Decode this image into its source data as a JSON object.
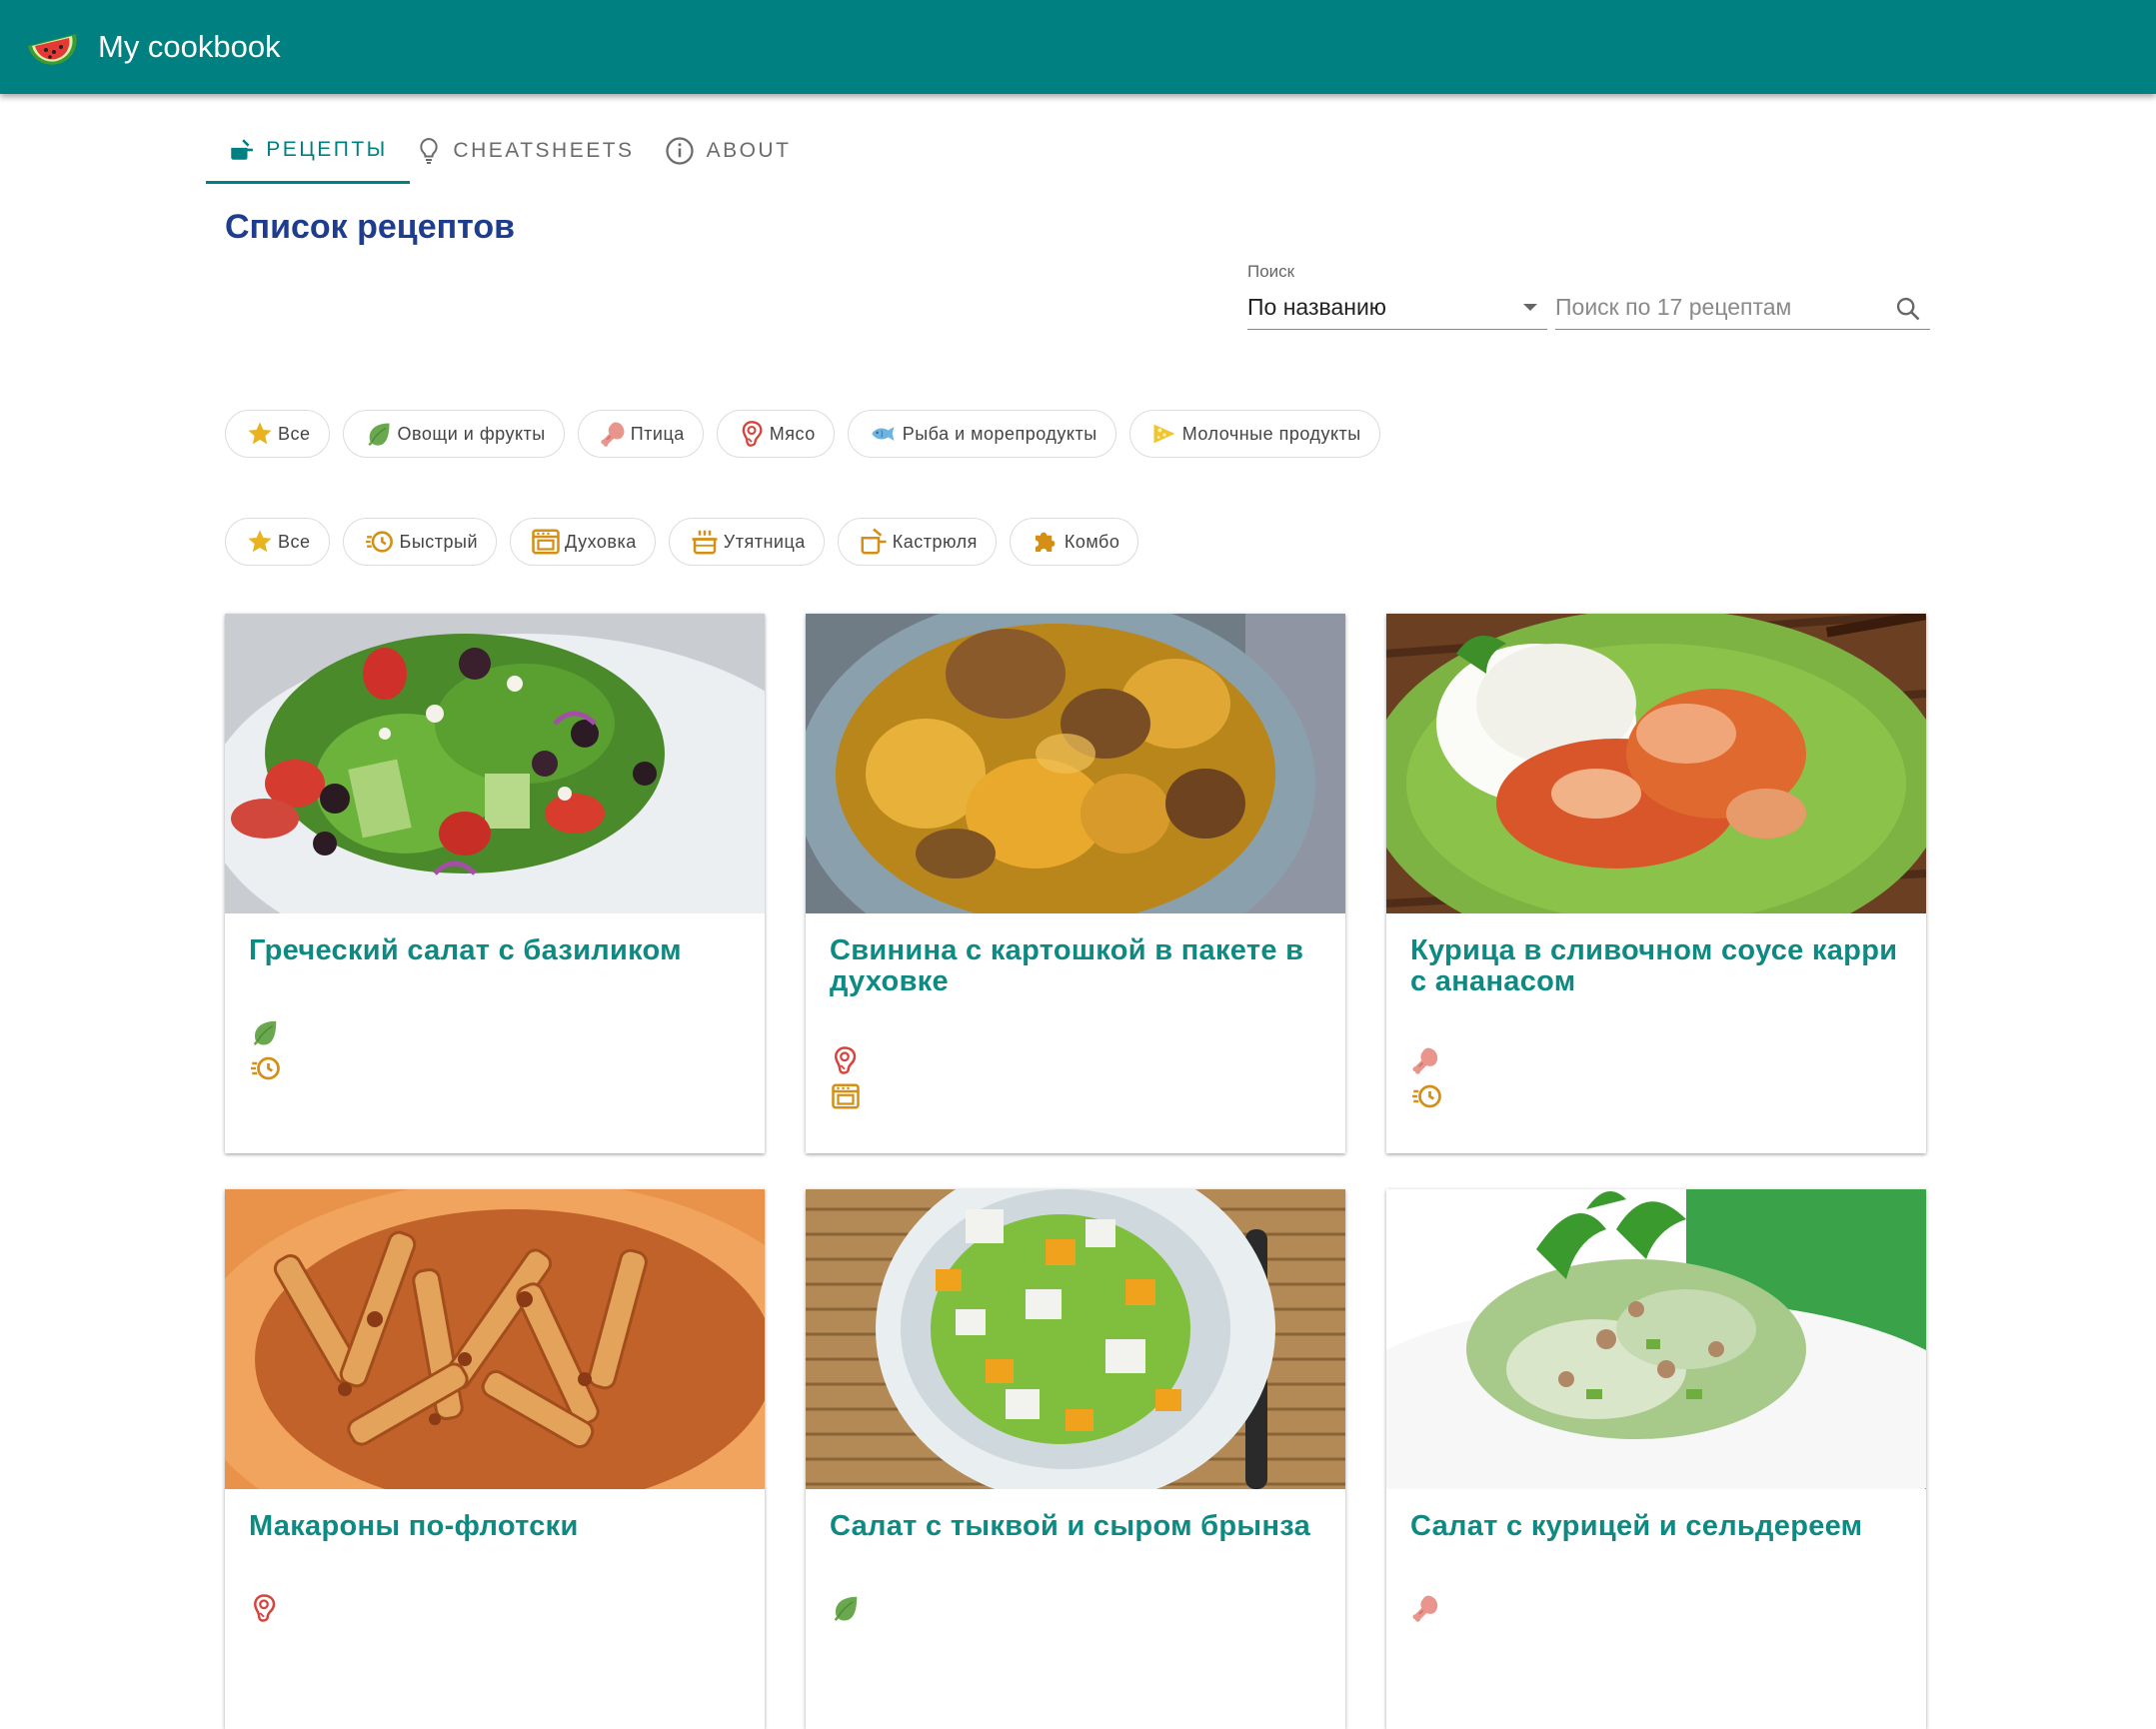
{
  "app": {
    "title": "My cookbook",
    "logo": "watermelon-icon",
    "color": "#008080"
  },
  "tabs": [
    {
      "label": "Рецепты",
      "icon": "pot-icon",
      "active": true
    },
    {
      "label": "Cheatsheets",
      "icon": "lightbulb-icon",
      "active": false
    },
    {
      "label": "About",
      "icon": "info-icon",
      "active": false
    }
  ],
  "page": {
    "title": "Список рецептов"
  },
  "search": {
    "label": "Поиск",
    "mode_value": "По названию",
    "placeholder": "Поиск по 17 рецептам"
  },
  "ingredient_filters": [
    {
      "label": "Все",
      "icon": "star-icon"
    },
    {
      "label": "Овощи и фрукты",
      "icon": "leaf-icon"
    },
    {
      "label": "Птица",
      "icon": "drumstick-icon"
    },
    {
      "label": "Мясо",
      "icon": "meat-icon"
    },
    {
      "label": "Рыба и морепродукты",
      "icon": "fish-icon"
    },
    {
      "label": "Молочные продукты",
      "icon": "cheese-icon"
    }
  ],
  "method_filters": [
    {
      "label": "Все",
      "icon": "star-icon"
    },
    {
      "label": "Быстрый",
      "icon": "fast-clock-icon"
    },
    {
      "label": "Духовка",
      "icon": "oven-icon"
    },
    {
      "label": "Утятница",
      "icon": "roaster-icon"
    },
    {
      "label": "Кастрюля",
      "icon": "saucepan-icon"
    },
    {
      "label": "Комбо",
      "icon": "puzzle-icon"
    }
  ],
  "recipes": [
    {
      "title": "Греческий салат с базиликом",
      "image": "greek-salad-photo",
      "tags": [
        "leaf-icon",
        "fast-clock-icon"
      ]
    },
    {
      "title": "Свинина с картошкой в пакете в духовке",
      "image": "pork-potatoes-photo",
      "tags": [
        "meat-icon",
        "oven-icon"
      ]
    },
    {
      "title": "Курица в сливочном соусе карри с ананасом",
      "image": "chicken-curry-rice-photo",
      "tags": [
        "drumstick-icon",
        "fast-clock-icon"
      ]
    },
    {
      "title": "Макароны по-флотски",
      "image": "pasta-photo",
      "tags": [
        "meat-icon"
      ]
    },
    {
      "title": "Салат с тыквой и сыром брынза",
      "image": "pumpkin-salad-photo",
      "tags": [
        "leaf-icon"
      ]
    },
    {
      "title": "Салат с курицей и сельдереем",
      "image": "chicken-celery-salad-photo",
      "tags": [
        "drumstick-icon"
      ]
    }
  ]
}
